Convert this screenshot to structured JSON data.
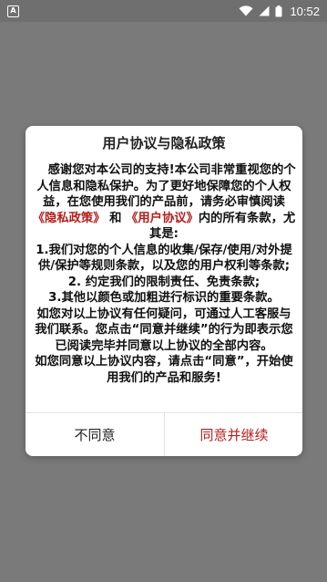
{
  "status_bar": {
    "notification_glyph": "A",
    "time": "10:52",
    "icons": [
      "wifi-icon",
      "signal-icon",
      "battery-icon"
    ]
  },
  "dialog": {
    "title": "用户协议与隐私政策",
    "intro_before": "感谢您对本公司的支持!本公司非常重视您的个人信息和隐私保护。为了更好地保障您的个人权益，在您使用我们的产品前，请务必审慎阅读",
    "privacy_link": "《隐私政策》",
    "and_text": "和",
    "user_agreement_link": "《用户协议》",
    "intro_after": "内的所有条款，尤其是:",
    "item1": "1.我们对您的个人信息的收集/保存/使用/对外提供/保护等规则条款，以及您的用户权利等条款;",
    "item2": "2. 约定我们的限制责任、免责条款;",
    "item3": "3.其他以颜色或加粗进行标识的重要条款。",
    "contact": "如您对以上协议有任何疑问，可通过人工客服与我们联系。您点击“同意并继续”的行为即表示您已阅读完毕并同意以上协议的全部内容。",
    "confirm": "如您同意以上协议内容，请点击“同意”，开始使用我们的产品和服务!",
    "disagree_label": "不同意",
    "agree_label": "同意并继续"
  },
  "colors": {
    "accent": "#b3201d",
    "overlay": "#7a7a7a"
  }
}
